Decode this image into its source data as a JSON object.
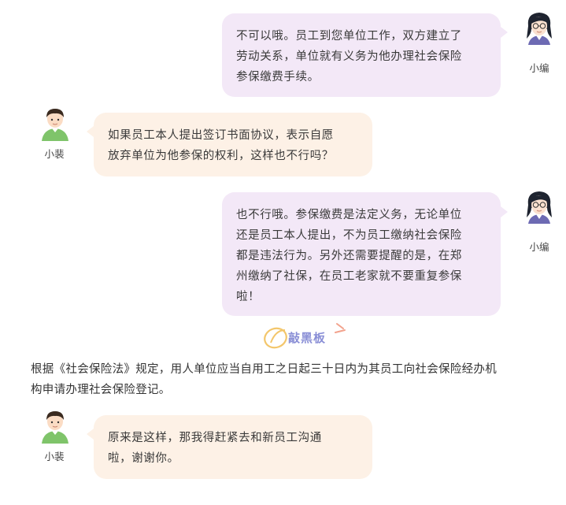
{
  "speakers": {
    "editor": "小编",
    "user": "小裴"
  },
  "messages": [
    {
      "role": "editor",
      "lines": [
        "不可以哦。员工到您单位工作，双方建立了",
        "劳动关系，单位就有义务为他办理社会保险",
        "参保缴费手续。"
      ]
    },
    {
      "role": "user",
      "lines": [
        "如果员工本人提出签订书面协议，表示自愿",
        "放弃单位为他参保的权利，这样也不行吗？"
      ]
    },
    {
      "role": "editor",
      "lines": [
        "也不行哦。参保缴费是法定义务，无论单位",
        "还是员工本人提出，不为员工缴纳社会保险",
        "都是违法行为。另外还需要提醒的是，在郑",
        "州缴纳了社保，在员工老家就不要重复参保",
        "啦！"
      ]
    },
    {
      "role": "user",
      "lines": [
        "原来是这样，那我得赶紧去和新员工沟通",
        "啦，谢谢你。"
      ]
    }
  ],
  "divider": {
    "label": "敲黑板"
  },
  "note": {
    "lines": [
      "根据《社会保险法》规定，用人单位应当自用工之日起三十日内为其员工向社会保险经办机",
      "构申请办理社会保险登记。"
    ]
  },
  "colors": {
    "editor_bubble": "#f3e8f7",
    "user_bubble": "#fdf1e6",
    "divider_accent": "#8a8fd6",
    "divider_ring": "#f3c66b"
  }
}
